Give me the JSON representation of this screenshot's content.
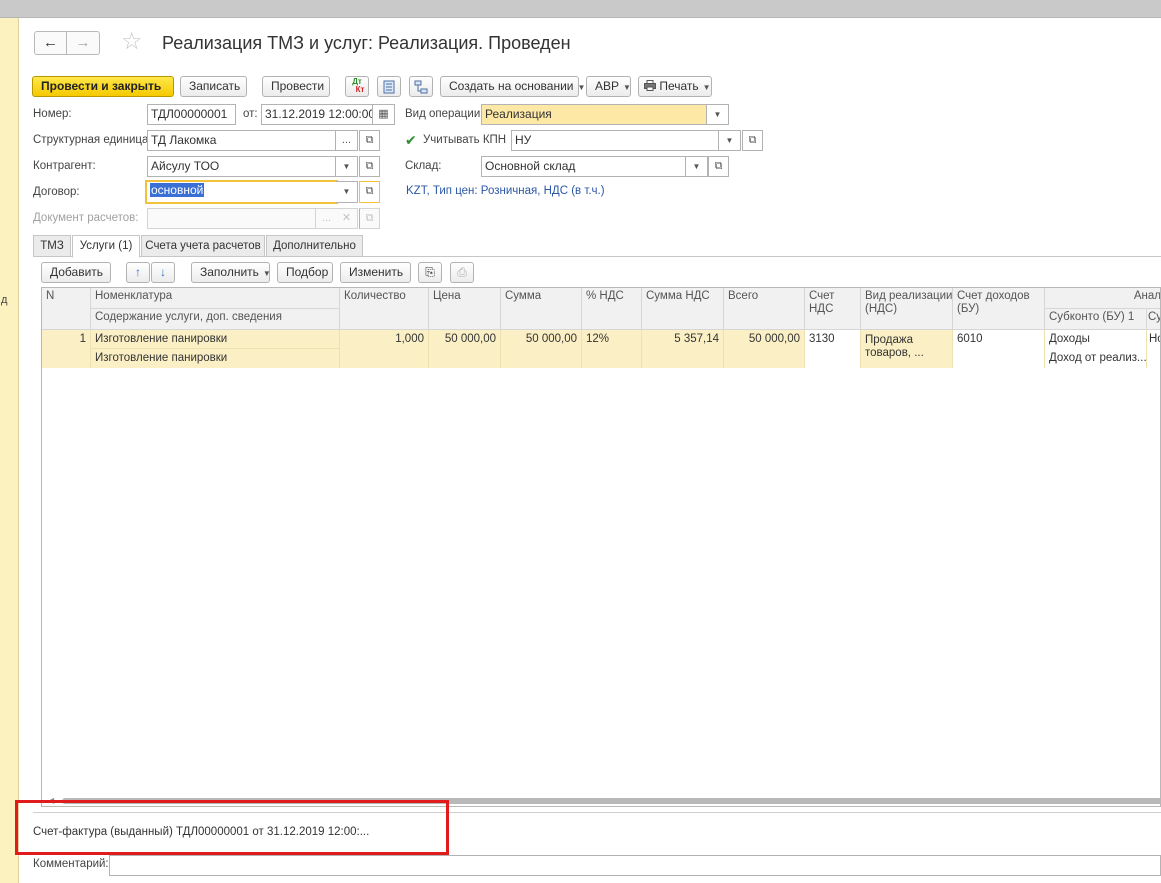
{
  "window": {
    "title": "Реализация ТМЗ и услуг: Реализация. Проведен"
  },
  "toolbar": {
    "post_close": "Провести и закрыть",
    "save": "Записать",
    "post": "Провести",
    "create_based": "Создать на основании",
    "avr": "АВР",
    "print": "Печать",
    "dtkt_top": "Дт",
    "dtkt_bottom": "Кт"
  },
  "form": {
    "number_label": "Номер:",
    "number_value": "ТДЛ00000001",
    "date_label": "от:",
    "date_value": "31.12.2019 12:00:00",
    "operation_label": "Вид операции:",
    "operation_value": "Реализация",
    "unit_label": "Структурная единица:",
    "unit_value": "ТД Лакомка",
    "kpn_checked": true,
    "kpn_label": "Учитывать КПН",
    "kpn_value": "НУ",
    "contractor_label": "Контрагент:",
    "contractor_value": "Айсулу ТОО",
    "warehouse_label": "Склад:",
    "warehouse_value": "Основной склад",
    "contract_label": "Договор:",
    "contract_value": "основной",
    "price_link": "KZT, Тип цен: Розничная, НДС (в т.ч.)",
    "settlement_doc_label": "Документ расчетов:",
    "settlement_doc_value": ""
  },
  "tabs": [
    {
      "label": "ТМЗ",
      "active": false
    },
    {
      "label": "Услуги (1)",
      "active": true
    },
    {
      "label": "Счета учета расчетов",
      "active": false
    },
    {
      "label": "Дополнительно",
      "active": false
    }
  ],
  "table_toolbar": {
    "add": "Добавить",
    "fill": "Заполнить",
    "pick": "Подбор",
    "edit": "Изменить"
  },
  "grid": {
    "headers": {
      "n": "N",
      "nomenclature": "Номенклатура",
      "content": "Содержание услуги, доп. сведения",
      "qty": "Количество",
      "price": "Цена",
      "sum": "Сумма",
      "vat_pct": "% НДС",
      "vat_sum": "Сумма НДС",
      "total": "Всего",
      "vat_account_1": "Счет",
      "vat_account_2": "НДС",
      "sale_type_1": "Вид реализации",
      "sale_type_2": "(НДС)",
      "income_account_1": "Счет доходов",
      "income_account_2": "(БУ)",
      "analytics": "Анал",
      "subconto1": "Субконто (БУ) 1",
      "subconto2": "Су"
    },
    "rows": [
      {
        "n": "1",
        "nomenclature": "Изготовление панировки",
        "content": "Изготовление панировки",
        "qty": "1,000",
        "price": "50 000,00",
        "sum": "50 000,00",
        "vat_pct": "12%",
        "vat_sum": "5 357,14",
        "total": "50 000,00",
        "vat_account": "3130",
        "sale_type_1": "Продажа",
        "sale_type_2": "товаров, ...",
        "income_account": "6010",
        "subconto1_a": "Доходы",
        "subconto1_b": "Доход от реализ...",
        "subconto2": "Но"
      }
    ]
  },
  "footer": {
    "invoice_link": "Счет-фактура (выданный) ТДЛ00000001 от 31.12.2019 12:00:...",
    "comment_label": "Комментарий:",
    "comment_value": ""
  },
  "side": {
    "glyph": "д"
  }
}
